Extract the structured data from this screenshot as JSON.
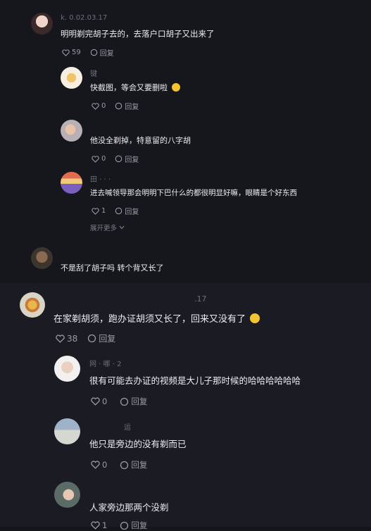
{
  "comments": [
    {
      "meta": "k. 0.02.03.17",
      "text": "明明剃完胡子去的，去落户口胡子又出来了",
      "likes": "59",
      "reply_label": "回复",
      "replies": [
        {
          "meta": "键",
          "text": "快截图，等会又要删啦",
          "likes": "0",
          "reply_label": "回复"
        },
        {
          "meta": "",
          "text": "他没全剃掉，特意留的八字胡",
          "likes": "0",
          "reply_label": "回复"
        },
        {
          "meta": "田 ·  ·  ·  ",
          "text": "进去喊领导那会明明下巴什么的都很明显好嘛，眼睛是个好东西",
          "likes": "1",
          "reply_label": "回复"
        }
      ],
      "expand_label": "展开更多"
    },
    {
      "meta": "",
      "text": "不是刮了胡子吗 转个背又长了"
    },
    {
      "meta": ".17",
      "text": "在家剃胡须，跑办证胡须又长了，回来又没有了",
      "likes": "38",
      "reply_label": "回复",
      "replies": [
        {
          "meta": "网 · 哪 · 2",
          "text": "很有可能去办证的视频是大儿子那时候的哈哈哈哈哈哈",
          "likes": "0",
          "reply_label": "回复"
        },
        {
          "meta": "运",
          "text": "他只是旁边的没有剃而已",
          "likes": "0",
          "reply_label": "回复"
        },
        {
          "meta": "",
          "text": "人家旁边那两个没剃",
          "likes": "1",
          "reply_label": "回复"
        }
      ]
    }
  ],
  "colors": {
    "background": "#15151c",
    "text": "#ececf2",
    "muted": "#9b9ba6"
  },
  "icons": {
    "like": "heart-icon",
    "reply": "comment-bubble-icon",
    "expand": "chevron-down-icon"
  }
}
